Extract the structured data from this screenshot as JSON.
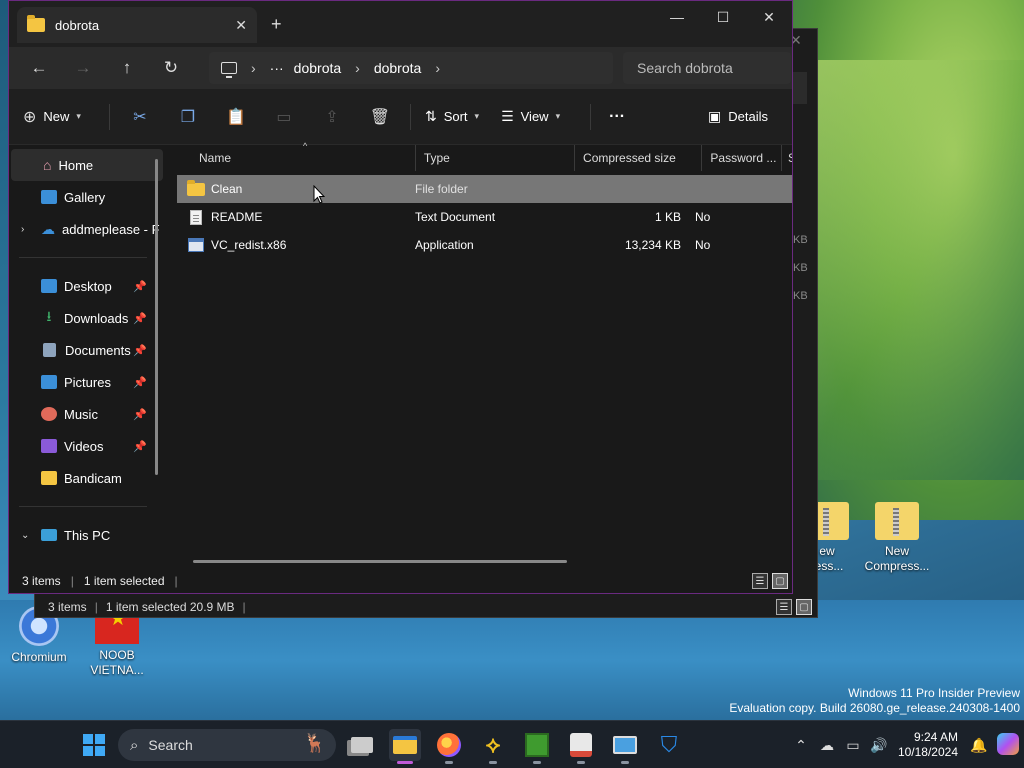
{
  "window": {
    "tab_title": "dobrota",
    "tab_close": "✕",
    "new_tab": "+",
    "minimize": "—",
    "maximize": "☐",
    "close": "✕"
  },
  "address": {
    "more": "···",
    "crumbs": [
      "dobrota",
      "dobrota"
    ],
    "search_placeholder": "Search dobrota"
  },
  "toolbar": {
    "new_label": "New",
    "sort_label": "Sort",
    "view_label": "View",
    "more": "···",
    "details_label": "Details"
  },
  "sidebar": {
    "home": "Home",
    "gallery": "Gallery",
    "onedrive": "addmeplease - F",
    "pinned": [
      {
        "label": "Desktop",
        "icon": "desktop-icon",
        "color": "#3b8fd8"
      },
      {
        "label": "Downloads",
        "icon": "download-icon",
        "color": "#3fb36b"
      },
      {
        "label": "Documents",
        "icon": "documents-icon",
        "color": "#8ea4bd"
      },
      {
        "label": "Pictures",
        "icon": "pictures-icon",
        "color": "#3b8fd8"
      },
      {
        "label": "Music",
        "icon": "music-icon",
        "color": "#e06a5a"
      },
      {
        "label": "Videos",
        "icon": "videos-icon",
        "color": "#8a5ad8"
      }
    ],
    "bandicam": "Bandicam",
    "this_pc": "This PC"
  },
  "columns": {
    "name": "Name",
    "type": "Type",
    "compressed_size": "Compressed size",
    "password": "Password ...",
    "size_partial": "Si"
  },
  "files": [
    {
      "name": "Clean",
      "type": "File folder",
      "size": "",
      "password": "",
      "icon": "folder"
    },
    {
      "name": "README",
      "type": "Text Document",
      "size": "1 KB",
      "password": "No",
      "icon": "doc"
    },
    {
      "name": "VC_redist.x86",
      "type": "Application",
      "size": "13,234 KB",
      "password": "No",
      "icon": "app"
    }
  ],
  "status": {
    "items": "3 items",
    "selected": "1 item selected"
  },
  "back_window": {
    "status_items": "3 items",
    "status_selected": "1 item selected  20.9 MB",
    "kb_labels": [
      "KB",
      "KB",
      "KB"
    ]
  },
  "desktop": {
    "icon_new1": "New\nCompress...",
    "icon_new1_line1": "ew",
    "icon_new1_line2": "ress...",
    "icon_new2_line1": "New",
    "icon_new2_line2": "Compress...",
    "chromium": "Chromium",
    "noob_line1": "NOOB",
    "noob_line2": "VIETNA..."
  },
  "watermark": {
    "line1": "Windows 11 Pro Insider Preview",
    "line2": "Evaluation copy. Build 26080.ge_release.240308-1400"
  },
  "taskbar": {
    "search_label": "Search",
    "time": "9:24 AM",
    "date": "10/18/2024"
  }
}
